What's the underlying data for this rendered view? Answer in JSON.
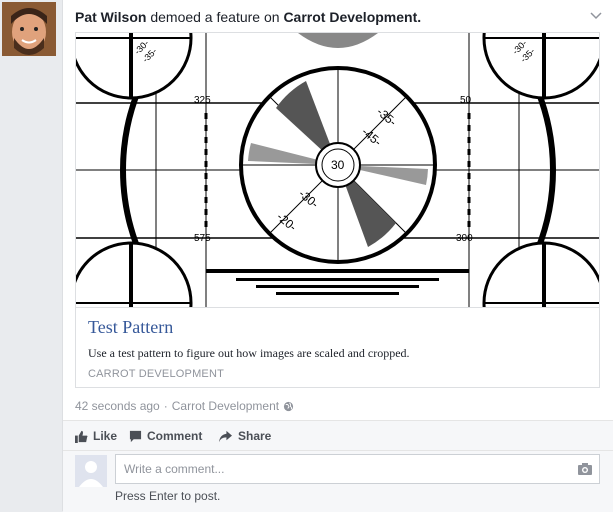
{
  "post": {
    "author": "Pat Wilson",
    "action_text": "demoed a feature on",
    "page_name": "Carrot Development.",
    "menu_icon": "chevron-down-icon"
  },
  "attachment": {
    "title": "Test Pattern",
    "description": "Use a test pattern to figure out how images are scaled and cropped.",
    "source": "CARROT DEVELOPMENT",
    "pattern_labels": {
      "top_left": "325",
      "top_right": "50",
      "bottom_left": "575",
      "bottom_right": "300",
      "center": "30",
      "upper_right_ticks": [
        "-35-",
        "-45-"
      ],
      "lower_left_ticks": [
        "-30-",
        "-20-"
      ],
      "corner_ticks": [
        "-30-",
        "-35-"
      ]
    }
  },
  "meta": {
    "time": "42 seconds ago",
    "separator": "·",
    "page_link": "Carrot Development",
    "privacy_icon": "globe-icon"
  },
  "actions": {
    "like": "Like",
    "comment": "Comment",
    "share": "Share"
  },
  "comment_box": {
    "placeholder": "Write a comment...",
    "hint": "Press Enter to post.",
    "camera_icon": "camera-icon"
  },
  "colors": {
    "link": "#365899",
    "muted": "#90949c",
    "background": "#e9ebee"
  }
}
